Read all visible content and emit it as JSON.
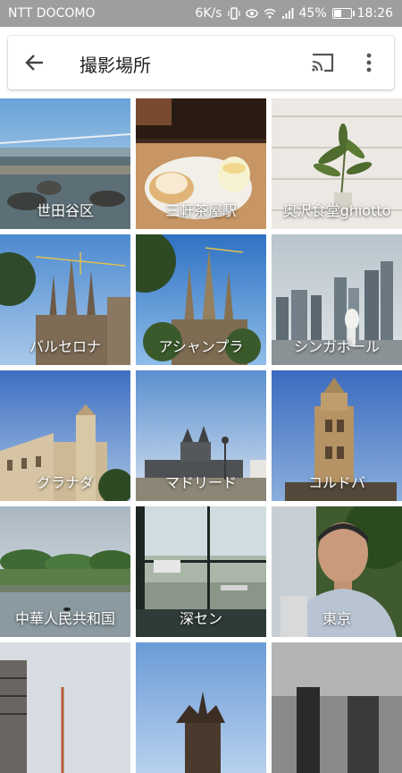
{
  "status": {
    "carrier": "NTT DOCOMO",
    "speed": "6K/s",
    "battery": "45%",
    "battery_level": 0.45,
    "time": "18:26"
  },
  "header": {
    "title": "撮影場所",
    "back_icon": "arrow-back-icon",
    "cast_icon": "cast-icon",
    "more_icon": "more-vert-icon"
  },
  "places": [
    {
      "label": "世田谷区"
    },
    {
      "label": "三軒茶屋駅"
    },
    {
      "label": "奥沢食堂ghiotto"
    },
    {
      "label": "バルセロナ"
    },
    {
      "label": "アシャンプラ"
    },
    {
      "label": "シンガポール"
    },
    {
      "label": "グラナダ"
    },
    {
      "label": "マドリード"
    },
    {
      "label": "コルドバ"
    },
    {
      "label": "中華人民共和国"
    },
    {
      "label": "深セン"
    },
    {
      "label": "東京"
    },
    {
      "label": ""
    },
    {
      "label": ""
    },
    {
      "label": ""
    }
  ]
}
